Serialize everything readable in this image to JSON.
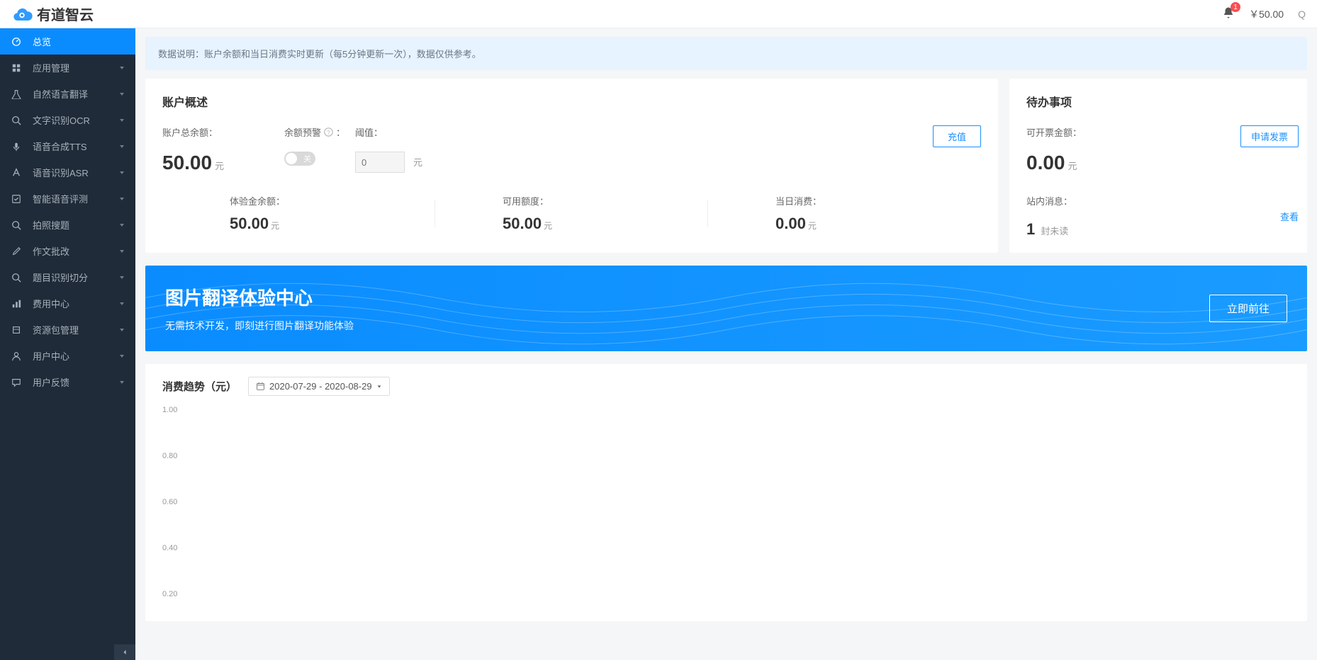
{
  "header": {
    "brand": "有道智云",
    "notifications": "1",
    "balance": "￥50.00",
    "avatar_hint": "Q"
  },
  "sidebar": {
    "items": [
      {
        "label": "总览",
        "active": true,
        "expandable": false,
        "icon": "dashboard"
      },
      {
        "label": "应用管理",
        "active": false,
        "expandable": true,
        "icon": "grid"
      },
      {
        "label": "自然语言翻译",
        "active": false,
        "expandable": true,
        "icon": "flask"
      },
      {
        "label": "文字识别OCR",
        "active": false,
        "expandable": true,
        "icon": "search"
      },
      {
        "label": "语音合成TTS",
        "active": false,
        "expandable": true,
        "icon": "mic"
      },
      {
        "label": "语音识别ASR",
        "active": false,
        "expandable": true,
        "icon": "font"
      },
      {
        "label": "智能语音评测",
        "active": false,
        "expandable": true,
        "icon": "check"
      },
      {
        "label": "拍照搜题",
        "active": false,
        "expandable": true,
        "icon": "search"
      },
      {
        "label": "作文批改",
        "active": false,
        "expandable": true,
        "icon": "edit"
      },
      {
        "label": "题目识别切分",
        "active": false,
        "expandable": true,
        "icon": "search"
      },
      {
        "label": "费用中心",
        "active": false,
        "expandable": true,
        "icon": "chart"
      },
      {
        "label": "资源包管理",
        "active": false,
        "expandable": true,
        "icon": "package"
      },
      {
        "label": "用户中心",
        "active": false,
        "expandable": true,
        "icon": "user"
      },
      {
        "label": "用户反馈",
        "active": false,
        "expandable": true,
        "icon": "comment"
      }
    ]
  },
  "notice": {
    "label": "数据说明：",
    "text": "账户余额和当日消费实时更新（每5分钟更新一次），数据仅供参考。"
  },
  "account": {
    "title": "账户概述",
    "balance_label": "账户总余额：",
    "balance_value": "50.00",
    "balance_unit": "元",
    "warn_label": "余额预警",
    "warn_toggle_text": "关",
    "threshold_label": "阈值：",
    "threshold_placeholder": "0",
    "threshold_unit": "元",
    "recharge_btn": "充值",
    "stats": [
      {
        "label": "体验金余额：",
        "value": "50.00",
        "unit": "元"
      },
      {
        "label": "可用额度：",
        "value": "50.00",
        "unit": "元"
      },
      {
        "label": "当日消费：",
        "value": "0.00",
        "unit": "元"
      }
    ]
  },
  "todo": {
    "title": "待办事项",
    "invoice_label": "可开票金额：",
    "invoice_value": "0.00",
    "invoice_unit": "元",
    "apply_btn": "申请发票",
    "msg_label": "站内消息：",
    "msg_count": "1",
    "msg_unread": "封未读",
    "view_link": "查看"
  },
  "banner": {
    "title": "图片翻译体验中心",
    "subtitle": "无需技术开发，即刻进行图片翻译功能体验",
    "button": "立即前往"
  },
  "chart": {
    "title": "消费趋势（元）",
    "date_range": "2020-07-29 - 2020-08-29"
  },
  "chart_data": {
    "type": "line",
    "title": "消费趋势（元）",
    "xlabel": "",
    "ylabel": "",
    "ylim": [
      0,
      1.0
    ],
    "y_ticks": [
      "1.00",
      "0.80",
      "0.60",
      "0.40",
      "0.20"
    ],
    "categories": [],
    "values": []
  }
}
